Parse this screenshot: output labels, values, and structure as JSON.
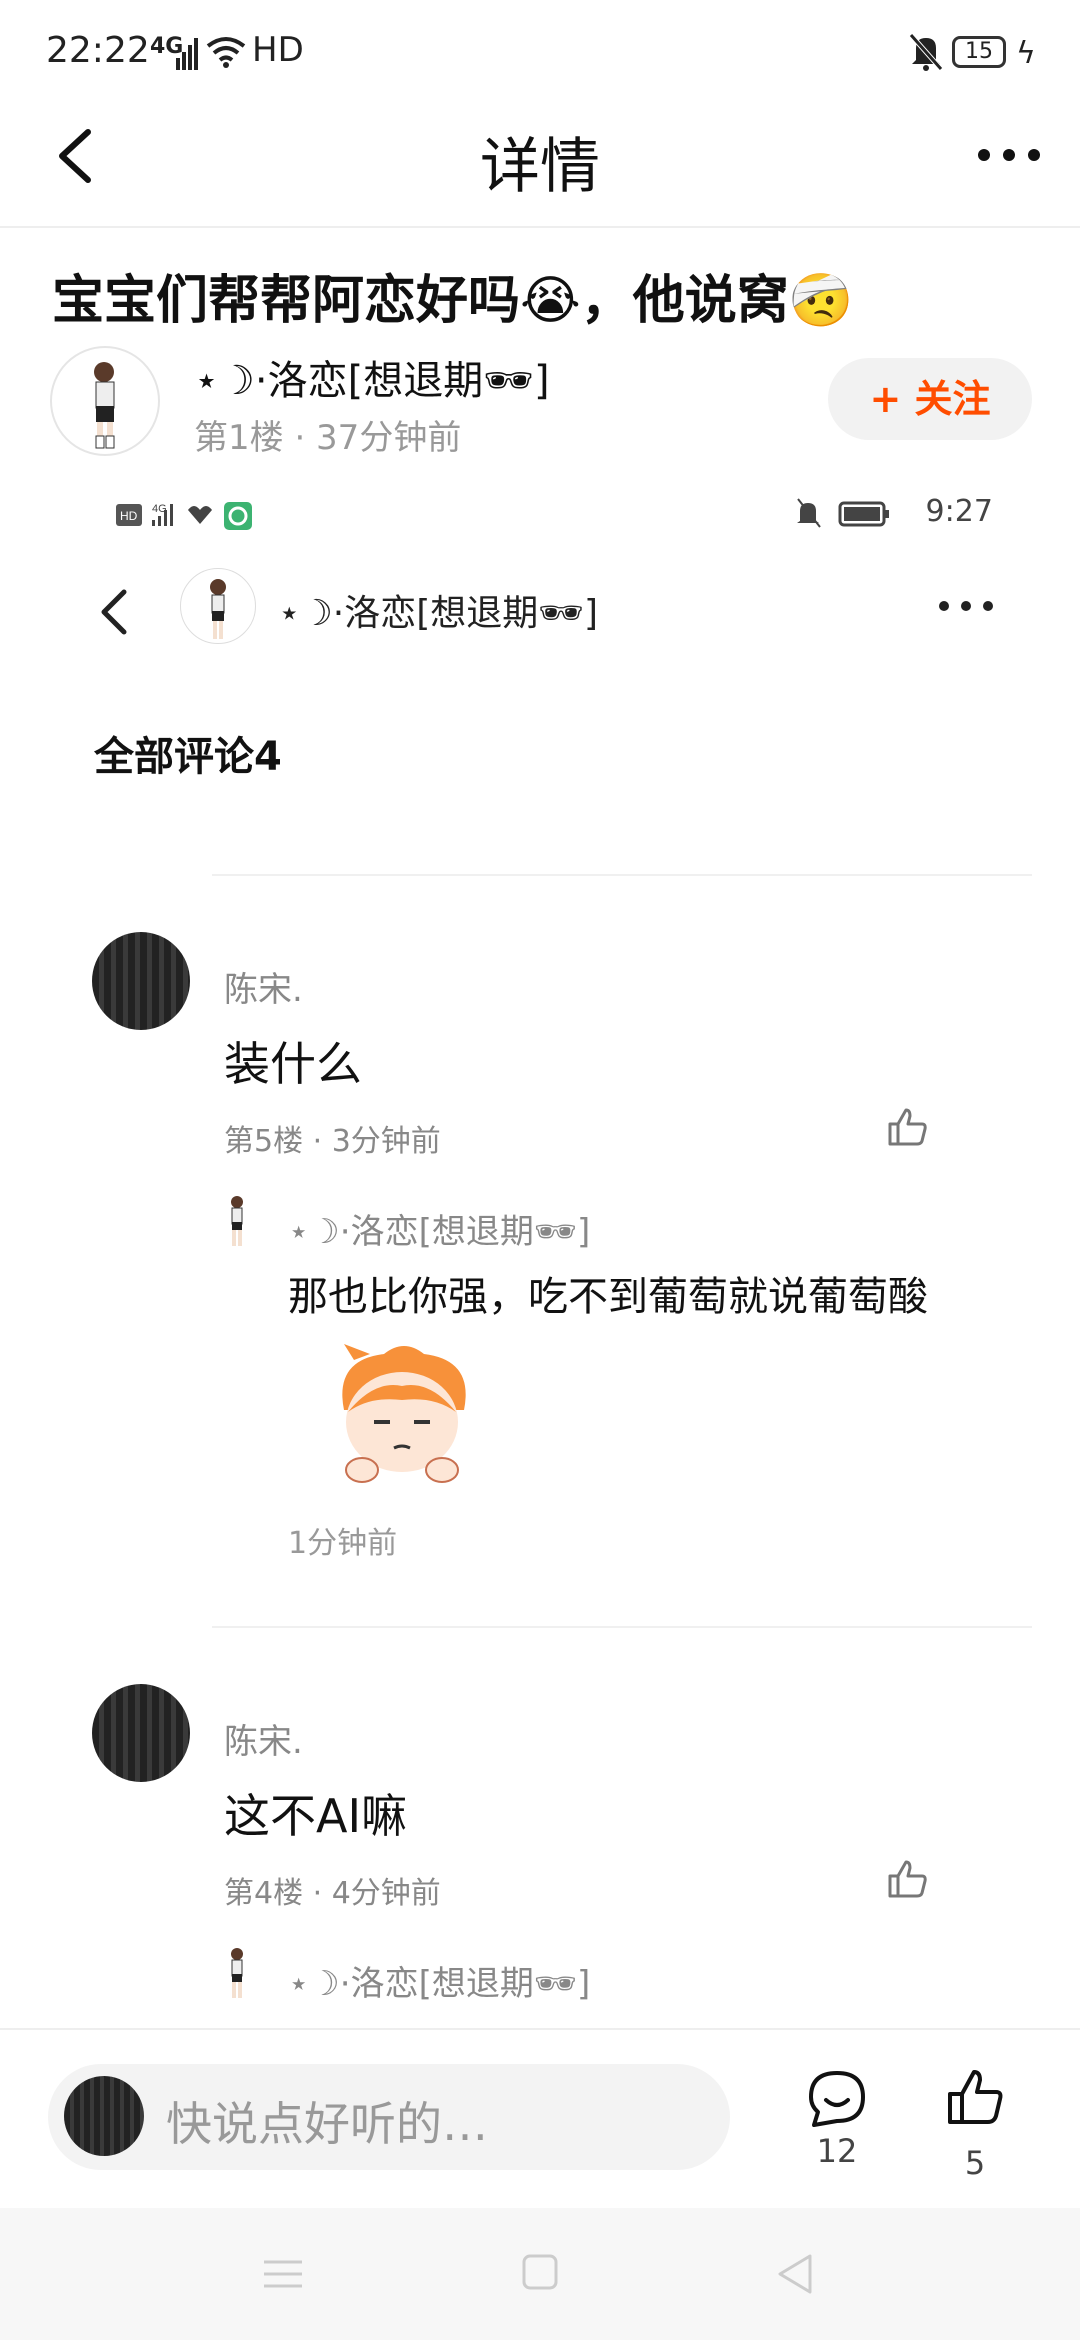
{
  "status_bar": {
    "time": "22:22",
    "network": "4G",
    "wifi_label": "HD",
    "battery": "15"
  },
  "top_bar": {
    "title": "详情"
  },
  "post": {
    "title": "宝宝们帮帮阿恋好吗😭，他说窝🤕",
    "author": "⋆☽·洛恋[想退期🕶]",
    "meta": "第1楼 · 37分钟前",
    "follow_label": "+ 关注"
  },
  "embedded": {
    "status_left": "HD 4G ᵢₗₗ ♡",
    "time": "9:27",
    "username": "⋆☽·洛恋[想退期🕶]",
    "comments_header": "全部评论4",
    "comments": [
      {
        "name": "陈宋.",
        "text": "装什么",
        "meta": "第5楼 · 3分钟前",
        "reply": {
          "name": "⋆☽·洛恋[想退期🕶]",
          "text": "那也比你强，吃不到葡萄就说葡萄酸",
          "meta": "1分钟前"
        }
      },
      {
        "name": "陈宋.",
        "text": "这不AI嘛",
        "meta": "第4楼 · 4分钟前",
        "reply": {
          "name": "⋆☽·洛恋[想退期🕶]"
        }
      }
    ]
  },
  "bottom_bar": {
    "input_placeholder": "快说点好听的…",
    "comment_count": "12",
    "like_count": "5"
  },
  "colors": {
    "accent": "#ff4d00",
    "follow_bg": "#f2f2f2",
    "muted_text": "#999999"
  },
  "icons": [
    "back-icon",
    "more-icon",
    "comment-icon",
    "like-icon",
    "bell-off-icon",
    "battery-icon",
    "wifi-icon",
    "nav-menu-icon",
    "nav-home-icon",
    "nav-back-icon"
  ]
}
